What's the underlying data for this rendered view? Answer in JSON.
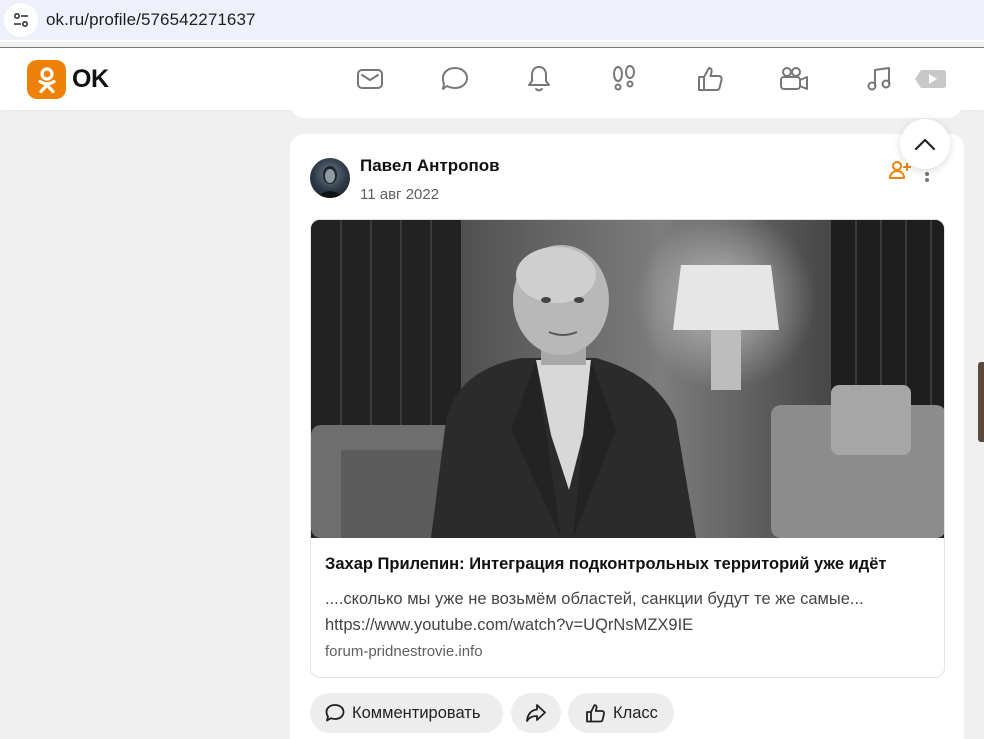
{
  "browser": {
    "url": "ok.ru/profile/576542271637"
  },
  "header": {
    "logo_text": "OK",
    "brand_color": "#ee8208",
    "nav_icons": [
      "mail-icon",
      "chat-icon",
      "bell-icon",
      "footprints-icon",
      "like-icon",
      "video-camera-icon",
      "music-icon",
      "video-play-icon"
    ]
  },
  "post": {
    "author": "Павел Антропов",
    "date": "11 авг 2022",
    "link": {
      "title": "Захар Прилепин: Интеграция подконтрольных территорий уже идёт",
      "description": "....сколько мы уже не возьмём областей, санкции будут те же самые...",
      "url_text": "https://www.youtube.com/watch?v=UQrNsMZX9IE",
      "domain": "forum-pridnestrovie.info"
    },
    "actions": {
      "comment_label": "Комментировать",
      "class_label": "Класс"
    }
  }
}
